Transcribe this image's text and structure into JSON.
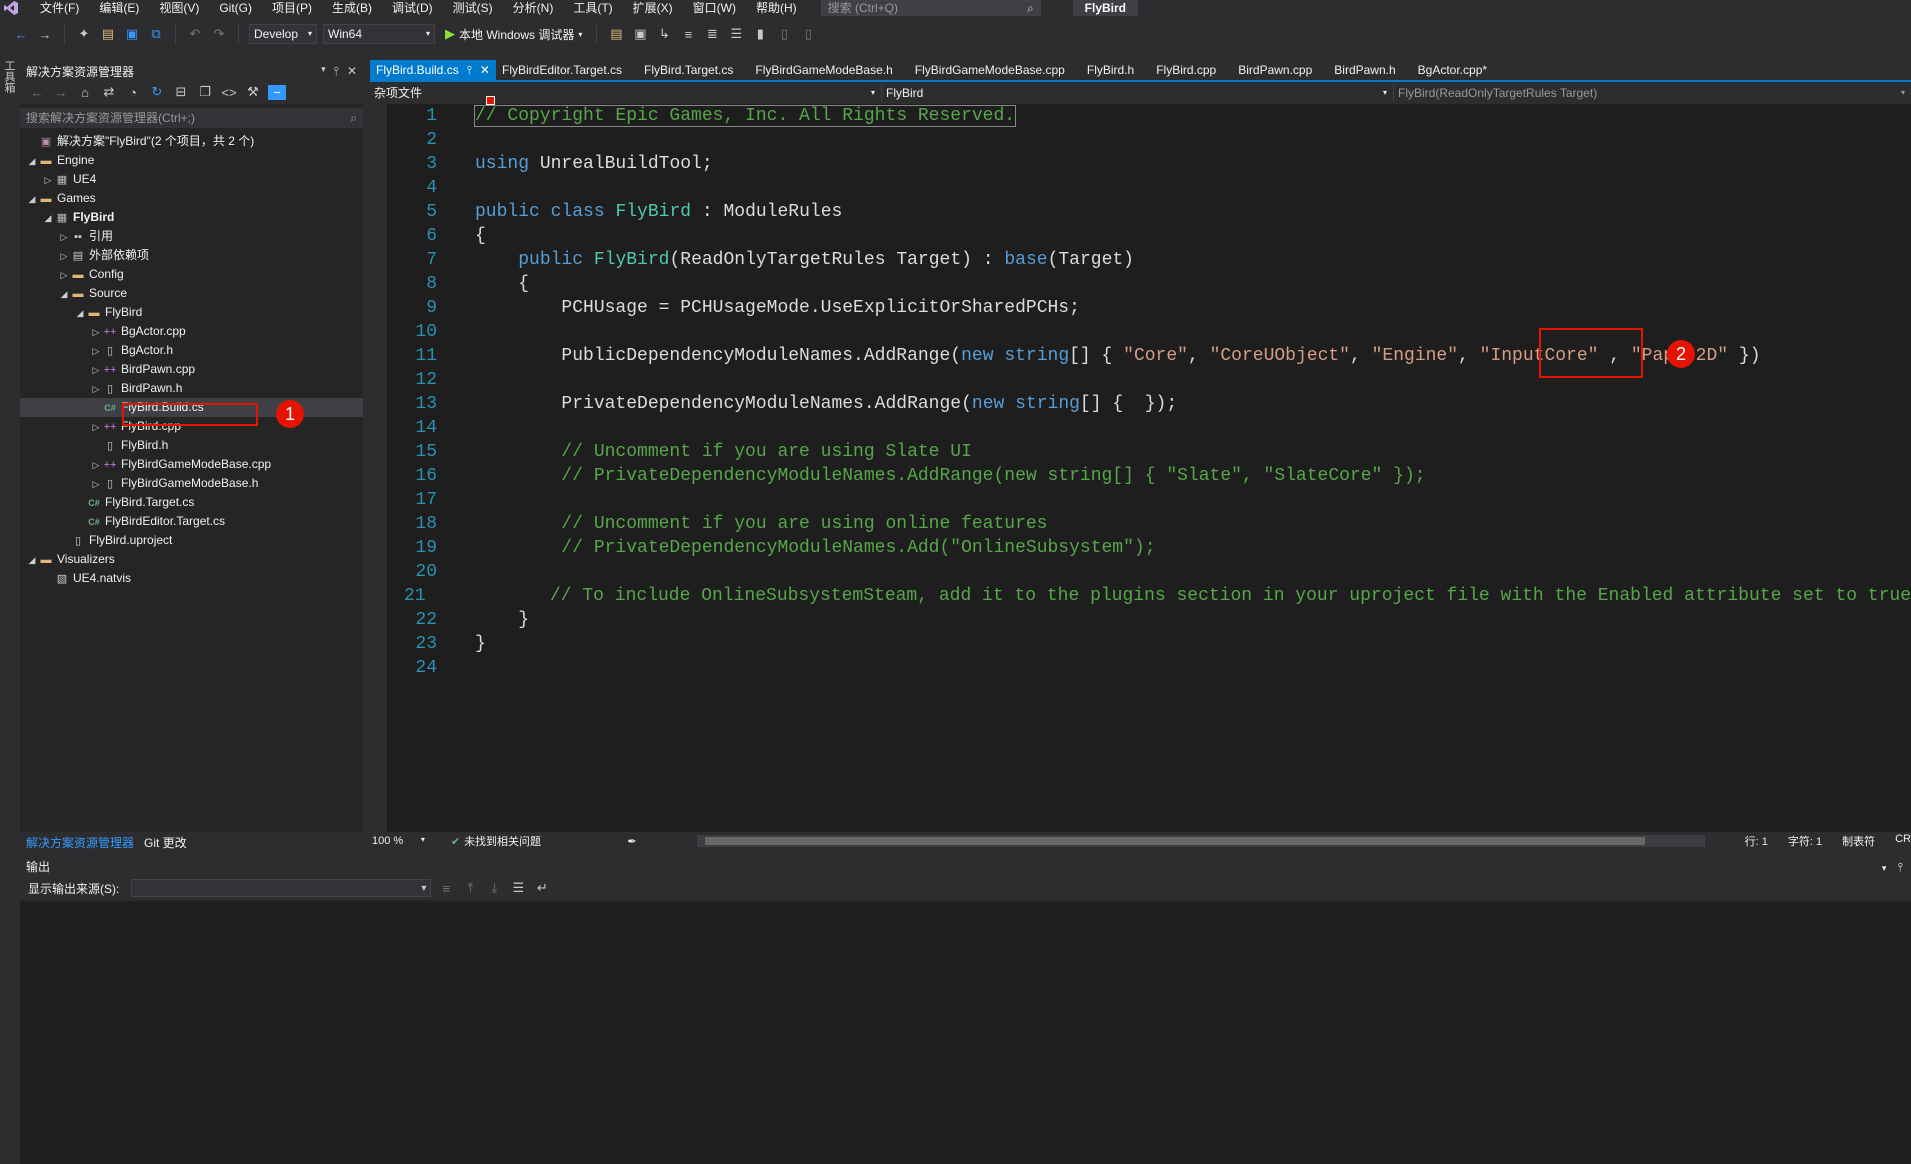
{
  "menubar": {
    "items": [
      "文件(F)",
      "编辑(E)",
      "视图(V)",
      "Git(G)",
      "项目(P)",
      "生成(B)",
      "调试(D)",
      "测试(S)",
      "分析(N)",
      "工具(T)",
      "扩展(X)",
      "窗口(W)",
      "帮助(H)"
    ],
    "search_placeholder": "搜索 (Ctrl+Q)",
    "solution_title": "FlyBird"
  },
  "toolbar": {
    "config": "Develop",
    "platform": "Win64",
    "run_label": "本地 Windows 调试器"
  },
  "left_strip": {
    "label": "工具箱"
  },
  "solution_explorer": {
    "title": "解决方案资源管理器",
    "search_placeholder": "搜索解决方案资源管理器(Ctrl+;)",
    "tree": [
      {
        "label": "解决方案\"FlyBird\"(2 个项目，共 2 个)",
        "depth": 0,
        "arrow": "",
        "icon": "solution-icon"
      },
      {
        "label": "Engine",
        "depth": 0,
        "arrow": "open",
        "icon": "folder-icon"
      },
      {
        "label": "UE4",
        "depth": 1,
        "arrow": "closed",
        "icon": "project-icon"
      },
      {
        "label": "Games",
        "depth": 0,
        "arrow": "open",
        "icon": "folder-icon"
      },
      {
        "label": "FlyBird",
        "depth": 1,
        "arrow": "open",
        "icon": "project-icon",
        "bold": true
      },
      {
        "label": "引用",
        "depth": 2,
        "arrow": "closed",
        "icon": "references-icon"
      },
      {
        "label": "外部依赖项",
        "depth": 2,
        "arrow": "closed",
        "icon": "external-deps-icon"
      },
      {
        "label": "Config",
        "depth": 2,
        "arrow": "closed",
        "icon": "folder-icon"
      },
      {
        "label": "Source",
        "depth": 2,
        "arrow": "open",
        "icon": "folder-icon"
      },
      {
        "label": "FlyBird",
        "depth": 3,
        "arrow": "open",
        "icon": "folder-icon"
      },
      {
        "label": "BgActor.cpp",
        "depth": 4,
        "arrow": "closed",
        "icon": "cpp-file-icon"
      },
      {
        "label": "BgActor.h",
        "depth": 4,
        "arrow": "closed",
        "icon": "header-file-icon"
      },
      {
        "label": "BirdPawn.cpp",
        "depth": 4,
        "arrow": "closed",
        "icon": "cpp-file-icon"
      },
      {
        "label": "BirdPawn.h",
        "depth": 4,
        "arrow": "closed",
        "icon": "header-file-icon"
      },
      {
        "label": "FlyBird.Build.cs",
        "depth": 4,
        "arrow": "",
        "icon": "cs-file-icon",
        "selected": true
      },
      {
        "label": "FlyBird.cpp",
        "depth": 4,
        "arrow": "closed",
        "icon": "cpp-file-icon"
      },
      {
        "label": "FlyBird.h",
        "depth": 4,
        "arrow": "",
        "icon": "header-file-icon"
      },
      {
        "label": "FlyBirdGameModeBase.cpp",
        "depth": 4,
        "arrow": "closed",
        "icon": "cpp-file-icon"
      },
      {
        "label": "FlyBirdGameModeBase.h",
        "depth": 4,
        "arrow": "closed",
        "icon": "header-file-icon"
      },
      {
        "label": "FlyBird.Target.cs",
        "depth": 3,
        "arrow": "",
        "icon": "cs-file-icon"
      },
      {
        "label": "FlyBirdEditor.Target.cs",
        "depth": 3,
        "arrow": "",
        "icon": "cs-file-icon"
      },
      {
        "label": "FlyBird.uproject",
        "depth": 2,
        "arrow": "",
        "icon": "uproject-file-icon"
      },
      {
        "label": "Visualizers",
        "depth": 0,
        "arrow": "open",
        "icon": "folder-icon"
      },
      {
        "label": "UE4.natvis",
        "depth": 1,
        "arrow": "",
        "icon": "natvis-file-icon"
      }
    ],
    "bottom_tabs": [
      "解决方案资源管理器",
      "Git 更改"
    ]
  },
  "annotations": {
    "badge1": "1",
    "badge2": "2"
  },
  "editor": {
    "tabs": [
      "FlyBird.Build.cs",
      "FlyBirdEditor.Target.cs",
      "FlyBird.Target.cs",
      "FlyBirdGameModeBase.h",
      "FlyBirdGameModeBase.cpp",
      "FlyBird.h",
      "FlyBird.cpp",
      "BirdPawn.cpp",
      "BirdPawn.h",
      "BgActor.cpp*"
    ],
    "nav": {
      "project": "杂项文件",
      "class": "FlyBird",
      "member": "FlyBird(ReadOnlyTargetRules Target)"
    },
    "lines": [
      {
        "n": "1",
        "parts": [
          [
            "cm",
            "// Copyright Epic Games, Inc. All Rights Reserved."
          ]
        ]
      },
      {
        "n": "2",
        "parts": []
      },
      {
        "n": "3",
        "parts": [
          [
            "kw",
            "using"
          ],
          [
            "pn",
            " UnrealBuildTool;"
          ]
        ]
      },
      {
        "n": "4",
        "parts": []
      },
      {
        "n": "5",
        "parts": [
          [
            "kw",
            "public"
          ],
          [
            "pn",
            " "
          ],
          [
            "kw",
            "class"
          ],
          [
            "pn",
            " "
          ],
          [
            "ty",
            "FlyBird"
          ],
          [
            "pn",
            " : ModuleRules"
          ]
        ]
      },
      {
        "n": "6",
        "parts": [
          [
            "pn",
            "{"
          ]
        ]
      },
      {
        "n": "7",
        "parts": [
          [
            "pn",
            "    "
          ],
          [
            "kw",
            "public"
          ],
          [
            "pn",
            " "
          ],
          [
            "ty",
            "FlyBird"
          ],
          [
            "pn",
            "(ReadOnlyTargetRules "
          ],
          [
            "pn",
            "Target"
          ],
          [
            "pn",
            ") : "
          ],
          [
            "kw",
            "base"
          ],
          [
            "pn",
            "(Target)"
          ]
        ]
      },
      {
        "n": "8",
        "parts": [
          [
            "pn",
            "    {"
          ]
        ]
      },
      {
        "n": "9",
        "parts": [
          [
            "pn",
            "        PCHUsage = PCHUsageMode.UseExplicitOrSharedPCHs;"
          ]
        ]
      },
      {
        "n": "10",
        "parts": []
      },
      {
        "n": "11",
        "parts": [
          [
            "pn",
            "        PublicDependencyModuleNames.AddRange("
          ],
          [
            "kw",
            "new"
          ],
          [
            "pn",
            " "
          ],
          [
            "kw",
            "string"
          ],
          [
            "pn",
            "[] { "
          ],
          [
            "str",
            "\"Core\""
          ],
          [
            "pn",
            ", "
          ],
          [
            "str",
            "\"CoreUObject\""
          ],
          [
            "pn",
            ", "
          ],
          [
            "str",
            "\"Engine\""
          ],
          [
            "pn",
            ", "
          ],
          [
            "str",
            "\"InputCore\""
          ],
          [
            "pn",
            " , "
          ],
          [
            "str",
            "\"Paper2D\""
          ],
          [
            "pn",
            " })"
          ]
        ]
      },
      {
        "n": "12",
        "parts": []
      },
      {
        "n": "13",
        "parts": [
          [
            "pn",
            "        PrivateDependencyModuleNames.AddRange("
          ],
          [
            "kw",
            "new"
          ],
          [
            "pn",
            " "
          ],
          [
            "kw",
            "string"
          ],
          [
            "pn",
            "[] {  });"
          ]
        ]
      },
      {
        "n": "14",
        "parts": []
      },
      {
        "n": "15",
        "parts": [
          [
            "cm",
            "        // Uncomment if you are using Slate UI"
          ]
        ]
      },
      {
        "n": "16",
        "parts": [
          [
            "cm",
            "        // PrivateDependencyModuleNames.AddRange(new string[] { \"Slate\", \"SlateCore\" });"
          ]
        ]
      },
      {
        "n": "17",
        "parts": []
      },
      {
        "n": "18",
        "parts": [
          [
            "cm",
            "        // Uncomment if you are using online features"
          ]
        ]
      },
      {
        "n": "19",
        "parts": [
          [
            "cm",
            "        // PrivateDependencyModuleNames.Add(\"OnlineSubsystem\");"
          ]
        ]
      },
      {
        "n": "20",
        "parts": []
      },
      {
        "n": "21",
        "parts": [
          [
            "cm",
            "        // To include OnlineSubsystemSteam, add it to the plugins section in your uproject file with the Enabled attribute set to true"
          ]
        ]
      },
      {
        "n": "22",
        "parts": [
          [
            "pn",
            "    }"
          ]
        ]
      },
      {
        "n": "23",
        "parts": [
          [
            "pn",
            "}"
          ]
        ]
      },
      {
        "n": "24",
        "parts": []
      }
    ]
  },
  "status": {
    "zoom": "100 %",
    "issues": "未找到相关问题",
    "line": "行: 1",
    "char": "字符: 1",
    "indent": "制表符",
    "eol": "CR"
  },
  "output": {
    "title": "输出",
    "source_label": "显示输出来源(S):"
  },
  "colors": {
    "accent": "#007acc",
    "annotation": "#e51400"
  }
}
